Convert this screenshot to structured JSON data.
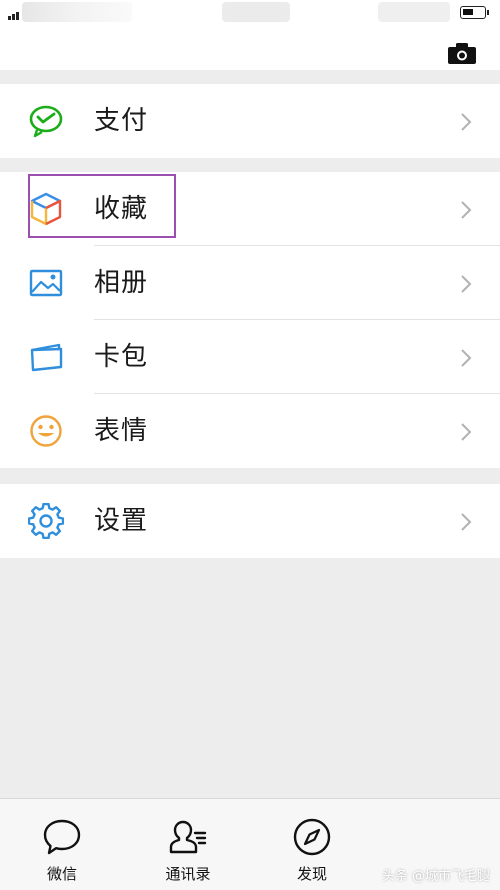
{
  "colors": {
    "background": "#ededed",
    "surface": "#ffffff",
    "text": "#1a1a1a",
    "divider": "#e3e3e3",
    "chevron": "#b2b2b2",
    "highlight_border": "#9b4fb0",
    "pay_icon": "#1aad19",
    "album_icon": "#2f8fdd",
    "card_icon": "#2f8fdd",
    "sticker_icon": "#f0a33a",
    "settings_icon": "#2f8fdd"
  },
  "groups": [
    {
      "items": [
        {
          "label": "支付",
          "icon": "wechat-pay-icon"
        }
      ]
    },
    {
      "items": [
        {
          "label": "收藏",
          "icon": "favorites-cube-icon",
          "highlighted": true
        },
        {
          "label": "相册",
          "icon": "album-picture-icon"
        },
        {
          "label": "卡包",
          "icon": "card-wallet-icon"
        },
        {
          "label": "表情",
          "icon": "smiley-sticker-icon"
        }
      ]
    },
    {
      "items": [
        {
          "label": "设置",
          "icon": "settings-gear-icon"
        }
      ]
    }
  ],
  "tabbar": {
    "tabs": [
      {
        "label": "微信",
        "icon": "chat-bubble-icon"
      },
      {
        "label": "通讯录",
        "icon": "contacts-icon"
      },
      {
        "label": "发现",
        "icon": "compass-icon"
      }
    ]
  },
  "watermark": "头条 @城市飞毛腿"
}
